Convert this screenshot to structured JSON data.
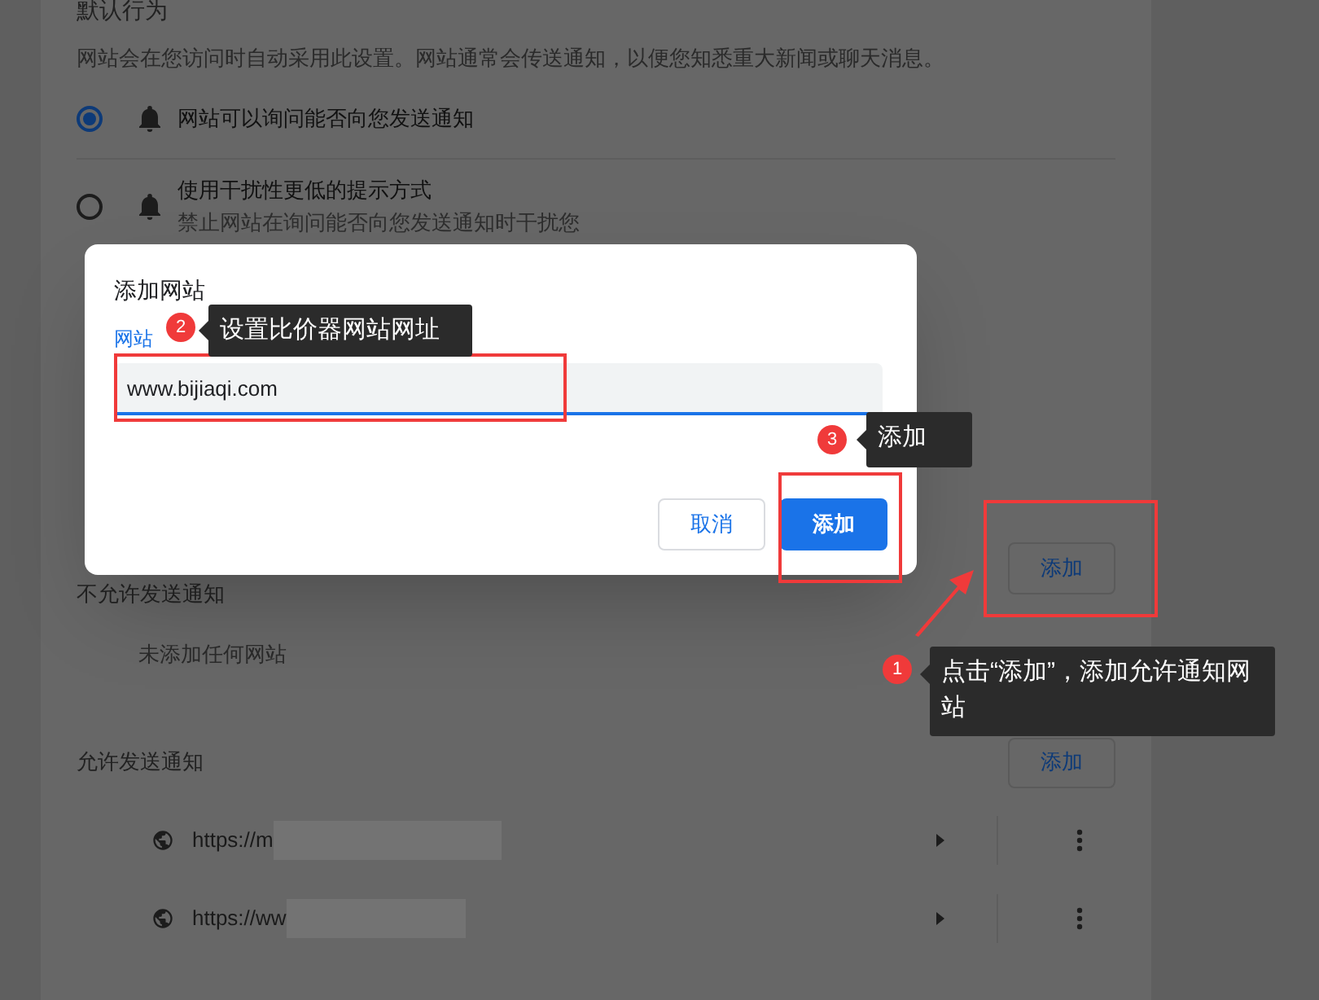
{
  "settings": {
    "heading": "默认行为",
    "description": "网站会在您访问时自动采用此设置。网站通常会传送通知，以便您知悉重大新闻或聊天消息。",
    "options": [
      {
        "label": "网站可以询问能否向您发送通知",
        "selected": true
      },
      {
        "label": "使用干扰性更低的提示方式",
        "description": "禁止网站在询问能否向您发送通知时干扰您",
        "selected": false
      }
    ]
  },
  "blocked": {
    "title": "不允许发送通知",
    "add_button": "添加",
    "empty_text": "未添加任何网站"
  },
  "allowed": {
    "title": "允许发送通知",
    "add_button": "添加",
    "sites": [
      {
        "url": "https://m"
      },
      {
        "url": "https://ww"
      }
    ]
  },
  "dialog": {
    "title": "添加网站",
    "field_label": "网站",
    "value": "www.bijiaqi.com",
    "buttons": [
      {
        "label": "取消",
        "kind": "secondary"
      },
      {
        "label": "添加",
        "kind": "primary"
      }
    ]
  },
  "annotations": [
    {
      "number": "2",
      "text": "设置比价器网站网址"
    },
    {
      "number": "3",
      "text": "添加"
    },
    {
      "number": "1",
      "text": "点击“添加”，添加允许通知网站"
    }
  ]
}
